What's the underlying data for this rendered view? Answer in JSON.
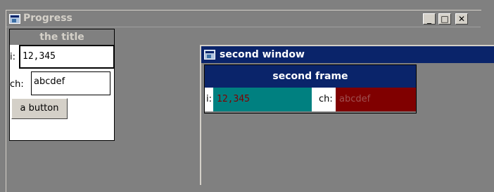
{
  "window1": {
    "title": "Progress",
    "controls": {
      "minimize": "_",
      "maximize": "□",
      "close": "✕"
    },
    "frame": {
      "title": "the title",
      "i_label": "i:",
      "i_value": "12,345",
      "ch_label": "ch:",
      "ch_value": "abcdef",
      "button_label": "a button"
    }
  },
  "window2": {
    "title": "second window",
    "frame": {
      "title": "second frame",
      "i_label": "i:",
      "i_value": "12,345",
      "ch_label": "ch:",
      "ch_value": "abcdef"
    }
  },
  "colors": {
    "desktop": "#808080",
    "active_title": "#0a246a",
    "teal_field": "#008080",
    "maroon_field": "#800000",
    "value_text": "#800000"
  },
  "icons": {
    "app": "app-window-icon"
  }
}
